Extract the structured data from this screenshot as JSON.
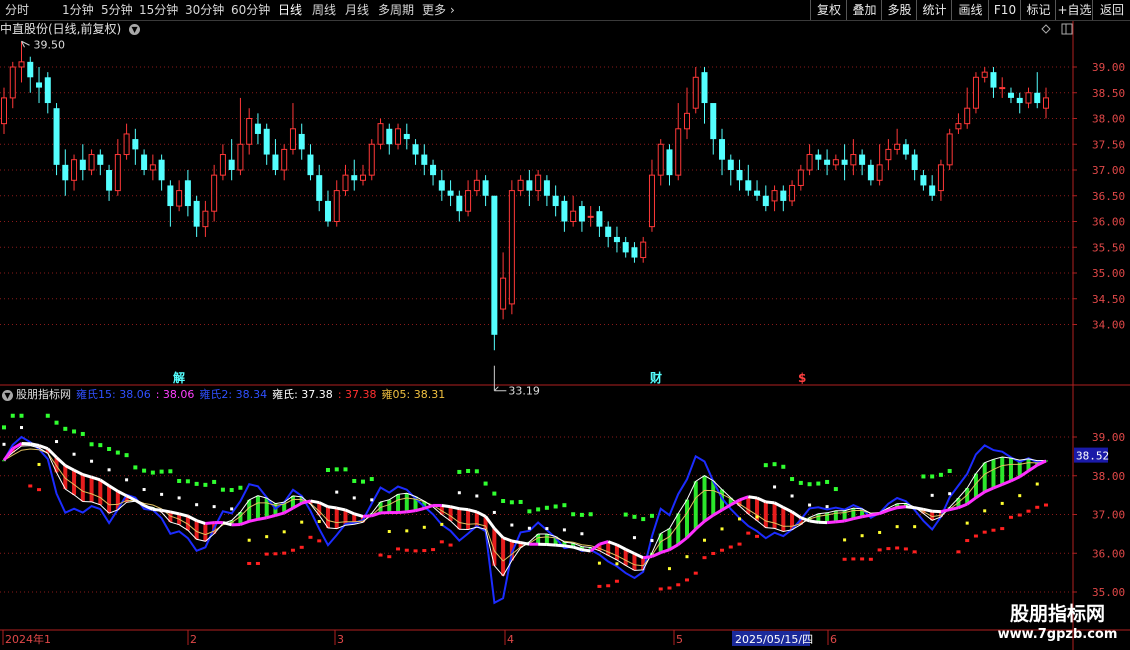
{
  "toolbar": {
    "periods": [
      {
        "label": "分时",
        "active": false
      },
      {
        "label": "1分钟",
        "active": false
      },
      {
        "label": "5分钟",
        "active": false
      },
      {
        "label": "15分钟",
        "active": false
      },
      {
        "label": "30分钟",
        "active": false
      },
      {
        "label": "60分钟",
        "active": false
      },
      {
        "label": "日线",
        "active": true
      },
      {
        "label": "周线",
        "active": false
      },
      {
        "label": "月线",
        "active": false
      },
      {
        "label": "多周期",
        "active": false
      },
      {
        "label": "更多",
        "active": false
      }
    ],
    "right_buttons": [
      "复权",
      "叠加",
      "多股",
      "统计",
      "画线",
      "F10",
      "标记",
      "+自选",
      "返回"
    ]
  },
  "stock": {
    "title": "中直股份(日线,前复权)",
    "high_label": "39.50",
    "low_label": "33.19",
    "events": [
      "解",
      "财",
      "$"
    ]
  },
  "indicator": {
    "name": "股朋指标网",
    "values": [
      {
        "label": "雍氏15: 38.06",
        "color": "#3050ff"
      },
      {
        "label": ": 38.06",
        "color": "#ff40ff"
      },
      {
        "label": "雍氏2: 38.34",
        "color": "#3050ff"
      },
      {
        "label": "雍氏: 37.38",
        "color": "#ffffff"
      },
      {
        "label": ": 37.38",
        "color": "#ff3030"
      },
      {
        "label": "雍05: 38.31",
        "color": "#f0c040"
      }
    ],
    "current_marker": "38.52"
  },
  "price_axis": [
    "39.00",
    "38.50",
    "38.00",
    "37.50",
    "37.00",
    "36.50",
    "36.00",
    "35.50",
    "35.00",
    "34.50",
    "34.00"
  ],
  "indicator_axis": [
    "39.00",
    "38.00",
    "37.00",
    "36.00",
    "35.00"
  ],
  "time_axis": [
    {
      "label": "2024年1",
      "highlight": false
    },
    {
      "label": "2",
      "highlight": false
    },
    {
      "label": "3",
      "highlight": false
    },
    {
      "label": "4",
      "highlight": false
    },
    {
      "label": "5",
      "highlight": false
    },
    {
      "label": "2025/05/15/四",
      "highlight": true
    },
    {
      "label": "6",
      "highlight": false
    }
  ],
  "watermark": {
    "title": "股朋指标网",
    "url": "www.7gpzb.com"
  },
  "colors": {
    "up": "#ff3838",
    "down": "#54ffff",
    "grid": "#8a1a1a",
    "axis": "#b02020",
    "blue": "#1c2cff",
    "magenta": "#ff30ff",
    "green": "#30ff30",
    "yellow": "#ffff30",
    "red": "#ff2020",
    "white": "#ffffff"
  },
  "chart_data": {
    "type": "candlestick",
    "y_range": [
      33.0,
      39.9
    ],
    "candles": [
      [
        37.9,
        38.4,
        38.6,
        37.7
      ],
      [
        38.4,
        39.0,
        39.1,
        38.2
      ],
      [
        39.0,
        39.1,
        39.5,
        38.7
      ],
      [
        39.1,
        38.8,
        39.2,
        38.5
      ],
      [
        38.7,
        38.6,
        39.0,
        38.3
      ],
      [
        38.8,
        38.3,
        38.9,
        38.1
      ],
      [
        38.2,
        37.1,
        38.3,
        36.9
      ],
      [
        37.1,
        36.8,
        37.4,
        36.5
      ],
      [
        36.8,
        37.2,
        37.3,
        36.6
      ],
      [
        37.2,
        37.0,
        37.5,
        36.8
      ],
      [
        37.0,
        37.3,
        37.4,
        36.9
      ],
      [
        37.3,
        37.1,
        37.4,
        36.9
      ],
      [
        37.0,
        36.6,
        37.1,
        36.4
      ],
      [
        36.6,
        37.3,
        37.6,
        36.5
      ],
      [
        37.3,
        37.7,
        37.9,
        37.2
      ],
      [
        37.6,
        37.4,
        37.8,
        37.1
      ],
      [
        37.3,
        37.0,
        37.4,
        36.9
      ],
      [
        37.0,
        37.1,
        37.3,
        36.8
      ],
      [
        37.2,
        36.8,
        37.3,
        36.6
      ],
      [
        36.7,
        36.3,
        36.8,
        35.9
      ],
      [
        36.3,
        36.6,
        36.8,
        36.2
      ],
      [
        36.8,
        36.3,
        37.0,
        36.1
      ],
      [
        36.4,
        35.9,
        36.5,
        35.7
      ],
      [
        35.9,
        36.2,
        36.4,
        35.7
      ],
      [
        36.2,
        36.9,
        37.1,
        36.0
      ],
      [
        36.9,
        37.3,
        37.5,
        36.8
      ],
      [
        37.2,
        37.0,
        37.6,
        36.8
      ],
      [
        37.0,
        37.5,
        38.4,
        36.9
      ],
      [
        37.5,
        38.0,
        38.2,
        37.3
      ],
      [
        37.9,
        37.7,
        38.1,
        37.5
      ],
      [
        37.8,
        37.3,
        37.9,
        37.1
      ],
      [
        37.3,
        37.0,
        37.6,
        36.9
      ],
      [
        37.0,
        37.4,
        37.5,
        36.8
      ],
      [
        37.4,
        37.8,
        38.3,
        37.3
      ],
      [
        37.7,
        37.4,
        37.9,
        37.2
      ],
      [
        37.3,
        36.9,
        37.5,
        36.8
      ],
      [
        36.9,
        36.4,
        37.1,
        36.2
      ],
      [
        36.4,
        36.0,
        36.6,
        35.9
      ],
      [
        36.0,
        36.6,
        36.8,
        35.9
      ],
      [
        36.6,
        36.9,
        37.1,
        36.5
      ],
      [
        36.9,
        36.8,
        37.2,
        36.6
      ],
      [
        36.8,
        36.9,
        37.1,
        36.7
      ],
      [
        36.9,
        37.5,
        37.6,
        36.8
      ],
      [
        37.5,
        37.9,
        38.0,
        37.4
      ],
      [
        37.8,
        37.5,
        37.9,
        37.3
      ],
      [
        37.5,
        37.8,
        37.9,
        37.4
      ],
      [
        37.7,
        37.6,
        37.9,
        37.4
      ],
      [
        37.5,
        37.3,
        37.6,
        37.1
      ],
      [
        37.3,
        37.1,
        37.5,
        36.9
      ],
      [
        37.1,
        36.9,
        37.2,
        36.7
      ],
      [
        36.8,
        36.6,
        37.0,
        36.4
      ],
      [
        36.6,
        36.5,
        36.8,
        36.3
      ],
      [
        36.5,
        36.2,
        36.6,
        36.0
      ],
      [
        36.2,
        36.6,
        36.8,
        36.1
      ],
      [
        36.6,
        36.8,
        37.0,
        36.5
      ],
      [
        36.8,
        36.5,
        36.9,
        36.3
      ],
      [
        36.5,
        33.8,
        36.5,
        33.5
      ],
      [
        34.3,
        34.9,
        35.4,
        34.1
      ],
      [
        34.4,
        36.6,
        36.8,
        34.2
      ],
      [
        36.6,
        36.8,
        36.9,
        36.5
      ],
      [
        36.8,
        36.6,
        37.0,
        36.3
      ],
      [
        36.6,
        36.9,
        37.0,
        36.4
      ],
      [
        36.8,
        36.5,
        36.9,
        36.3
      ],
      [
        36.5,
        36.3,
        36.7,
        36.1
      ],
      [
        36.4,
        36.0,
        36.5,
        35.8
      ],
      [
        36.0,
        36.2,
        36.5,
        35.9
      ],
      [
        36.3,
        36.0,
        36.4,
        35.8
      ],
      [
        36.1,
        36.1,
        36.3,
        35.9
      ],
      [
        36.2,
        35.9,
        36.3,
        35.7
      ],
      [
        35.9,
        35.7,
        36.0,
        35.5
      ],
      [
        35.7,
        35.6,
        35.9,
        35.4
      ],
      [
        35.6,
        35.4,
        35.7,
        35.3
      ],
      [
        35.5,
        35.3,
        35.6,
        35.2
      ],
      [
        35.3,
        35.6,
        35.7,
        35.2
      ],
      [
        35.9,
        36.9,
        37.2,
        35.8
      ],
      [
        36.9,
        37.5,
        37.6,
        36.7
      ],
      [
        37.4,
        36.9,
        37.5,
        36.7
      ],
      [
        36.9,
        37.8,
        38.3,
        36.8
      ],
      [
        37.8,
        38.1,
        38.6,
        37.6
      ],
      [
        38.2,
        38.8,
        39.0,
        38.1
      ],
      [
        38.9,
        38.3,
        39.0,
        37.9
      ],
      [
        38.3,
        37.6,
        38.2,
        37.3
      ],
      [
        37.6,
        37.2,
        37.8,
        36.9
      ],
      [
        37.2,
        37.0,
        37.3,
        36.7
      ],
      [
        37.0,
        36.8,
        37.2,
        36.6
      ],
      [
        36.8,
        36.6,
        37.1,
        36.5
      ],
      [
        36.6,
        36.5,
        36.8,
        36.4
      ],
      [
        36.5,
        36.3,
        36.7,
        36.2
      ],
      [
        36.4,
        36.6,
        36.7,
        36.2
      ],
      [
        36.6,
        36.4,
        36.7,
        36.2
      ],
      [
        36.4,
        36.7,
        36.8,
        36.3
      ],
      [
        36.7,
        37.0,
        37.1,
        36.6
      ],
      [
        37.0,
        37.3,
        37.5,
        36.9
      ],
      [
        37.3,
        37.2,
        37.4,
        37.0
      ],
      [
        37.2,
        37.1,
        37.4,
        36.9
      ],
      [
        37.1,
        37.2,
        37.3,
        37.0
      ],
      [
        37.2,
        37.1,
        37.5,
        36.8
      ],
      [
        37.1,
        37.3,
        37.6,
        36.9
      ],
      [
        37.3,
        37.1,
        37.4,
        36.9
      ],
      [
        37.1,
        36.8,
        37.2,
        36.7
      ],
      [
        36.8,
        37.1,
        37.5,
        36.7
      ],
      [
        37.2,
        37.4,
        37.6,
        37.0
      ],
      [
        37.4,
        37.5,
        37.8,
        37.3
      ],
      [
        37.5,
        37.3,
        37.6,
        37.2
      ],
      [
        37.3,
        37.0,
        37.4,
        36.8
      ],
      [
        36.9,
        36.7,
        37.0,
        36.6
      ],
      [
        36.7,
        36.5,
        36.9,
        36.4
      ],
      [
        36.6,
        37.1,
        37.2,
        36.4
      ],
      [
        37.1,
        37.7,
        37.8,
        37.0
      ],
      [
        37.8,
        37.9,
        38.1,
        37.7
      ],
      [
        37.9,
        38.2,
        38.6,
        37.8
      ],
      [
        38.2,
        38.8,
        38.9,
        38.1
      ],
      [
        38.8,
        38.9,
        39.0,
        38.7
      ],
      [
        38.9,
        38.6,
        39.0,
        38.4
      ],
      [
        38.6,
        38.6,
        38.8,
        38.4
      ],
      [
        38.5,
        38.4,
        38.6,
        38.3
      ],
      [
        38.4,
        38.3,
        38.5,
        38.1
      ],
      [
        38.3,
        38.5,
        38.6,
        38.2
      ],
      [
        38.5,
        38.3,
        38.9,
        38.2
      ],
      [
        38.2,
        38.4,
        38.6,
        38.0
      ]
    ]
  }
}
